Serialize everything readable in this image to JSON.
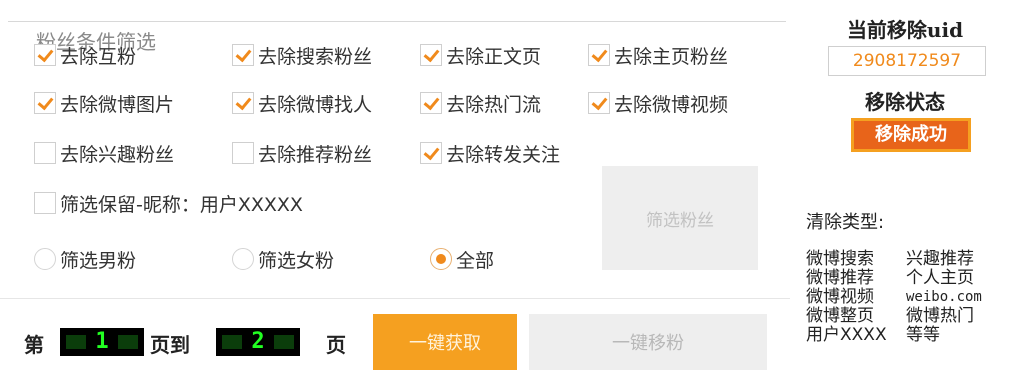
{
  "filter": {
    "legend": "粉丝条件筛选",
    "checkboxes": [
      {
        "label": "去除互粉",
        "checked": true
      },
      {
        "label": "去除搜索粉丝",
        "checked": true
      },
      {
        "label": "去除正文页",
        "checked": true
      },
      {
        "label": "去除主页粉丝",
        "checked": true
      },
      {
        "label": "去除微博图片",
        "checked": true
      },
      {
        "label": "去除微博找人",
        "checked": true
      },
      {
        "label": "去除热门流",
        "checked": true
      },
      {
        "label": "去除微博视频",
        "checked": true
      },
      {
        "label": "去除兴趣粉丝",
        "checked": false
      },
      {
        "label": "去除推荐粉丝",
        "checked": false
      },
      {
        "label": "去除转发关注",
        "checked": true
      }
    ],
    "keep_nickname": {
      "label": "筛选保留-昵称：",
      "value": "用户XXXXX",
      "checked": false
    },
    "radios": [
      {
        "label": "筛选男粉",
        "selected": false
      },
      {
        "label": "筛选女粉",
        "selected": false
      },
      {
        "label": "全部",
        "selected": true
      }
    ],
    "filter_button": "筛选粉丝"
  },
  "pager": {
    "prefix": "第",
    "start_page": "1",
    "middle": "页到",
    "end_page": "2",
    "suffix": "页"
  },
  "actions": {
    "fetch_button": "一键获取",
    "remove_button": "一键移粉"
  },
  "side": {
    "current_uid_label": "当前移除uid",
    "current_uid": "2908172597",
    "status_label": "移除状态",
    "status_value": "移除成功",
    "clear_types_label": "清除类型:",
    "clear_types": [
      [
        "微博搜索",
        "兴趣推荐"
      ],
      [
        "微博推荐",
        "个人主页"
      ],
      [
        "微博视频",
        "weibo.com"
      ],
      [
        "微博整页",
        "微博热门"
      ],
      [
        "用户XXXX",
        "等等"
      ]
    ]
  },
  "colors": {
    "accent": "#f5a020",
    "check": "#f08a1c",
    "status_bg": "#e8641a",
    "lcd_text": "#22ff22"
  }
}
